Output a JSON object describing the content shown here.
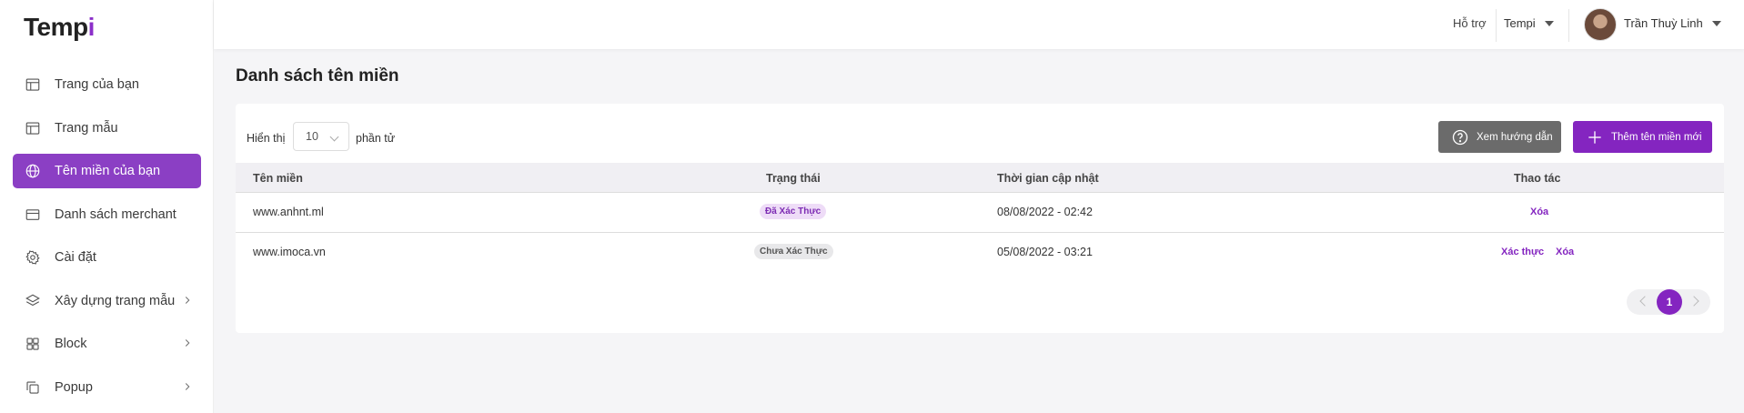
{
  "app": {
    "logo_main": "Temp",
    "logo_accent": "i"
  },
  "sidebar": {
    "items": [
      {
        "label": "Trang của bạn",
        "icon": "layout-icon"
      },
      {
        "label": "Trang mẫu",
        "icon": "template-icon"
      },
      {
        "label": "Tên miền của bạn",
        "icon": "globe-icon",
        "active": true
      },
      {
        "label": "Danh sách merchant",
        "icon": "card-icon"
      },
      {
        "label": "Cài đặt",
        "icon": "gear-icon"
      },
      {
        "label": "Xây dựng trang mẫu",
        "icon": "layers-icon",
        "expandable": true
      },
      {
        "label": "Block",
        "icon": "grid-icon",
        "expandable": true
      },
      {
        "label": "Popup",
        "icon": "copy-icon",
        "expandable": true
      }
    ]
  },
  "topbar": {
    "support": "Hỗ trợ",
    "brand": "Tempi",
    "user_name": "Trần Thuỳ Linh"
  },
  "page": {
    "title": "Danh sách tên miền"
  },
  "toolbar": {
    "show_label": "Hiển thị",
    "page_size": "10",
    "elements_label": "phần tử",
    "guide_button": "Xem hướng dẫn",
    "add_button": "Thêm tên miền mới"
  },
  "table": {
    "headers": [
      "Tên miền",
      "Trạng thái",
      "Thời gian cập nhật",
      "Thao tác"
    ],
    "rows": [
      {
        "domain": "www.anhnt.ml",
        "status": "Đã Xác Thực",
        "verified": true,
        "updated": "08/08/2022 - 02:42",
        "actions": [
          "Xóa"
        ]
      },
      {
        "domain": "www.imoca.vn",
        "status": "Chưa Xác Thực",
        "verified": false,
        "updated": "05/08/2022 - 03:21",
        "actions": [
          "Xác thực",
          "Xóa"
        ]
      }
    ]
  },
  "pagination": {
    "current_page": "1"
  },
  "colors": {
    "accent": "#8425c0",
    "active_nav": "#8b3fc4",
    "badge_ok_bg": "#eedcf7",
    "guide_button": "#6b6b6b"
  }
}
